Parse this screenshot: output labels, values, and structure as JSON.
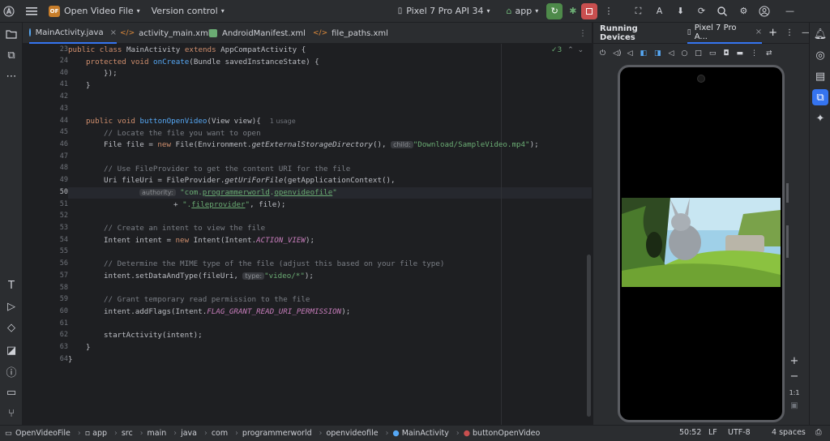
{
  "titlebar": {
    "project_badge": "OF",
    "project_name": "Open Video File",
    "vcs": "Version control",
    "device": "Pixel 7 Pro API 34",
    "run_config": "app"
  },
  "tabs": [
    {
      "label": "MainActivity.java",
      "color": "#56a8f5"
    },
    {
      "label": "activity_main.xml",
      "color": "#e08b3a"
    },
    {
      "label": "AndroidManifest.xml",
      "color": "#6aab73"
    },
    {
      "label": "file_paths.xml",
      "color": "#e08b3a"
    }
  ],
  "inspection_count": "3",
  "lines": {
    "n23": "23",
    "n24": "24",
    "n40": "40",
    "n41": "41",
    "n42": "42",
    "n43": "43",
    "n44": "44",
    "n45": "45",
    "n46": "46",
    "n47": "47",
    "n48": "48",
    "n49": "49",
    "n50": "50",
    "n51": "51",
    "n52": "52",
    "n53": "53",
    "n54": "54",
    "n55": "55",
    "n56": "56",
    "n57": "57",
    "n58": "58",
    "n59": "59",
    "n60": "60",
    "n61": "61",
    "n62": "62",
    "n63": "63",
    "n64": "64"
  },
  "code": {
    "l23a": "public",
    "l23b": " ",
    "l23c": "class",
    "l23d": " MainActivity ",
    "l23e": "extends",
    "l23f": " AppCompatActivity {",
    "l24a": "protected",
    "l24b": " ",
    "l24c": "void",
    "l24d": " ",
    "l24e": "onCreate",
    "l24f": "(Bundle savedInstanceState) {",
    "l40": "});",
    "l41": "}",
    "l44a": "public",
    "l44b": " ",
    "l44c": "void",
    "l44d": " ",
    "l44e": "buttonOpenVideo",
    "l44f": "(View view){",
    "l44usage": "1 usage",
    "l45": "// Locate the file you want to open",
    "l46a": "File file = ",
    "l46b": "new",
    "l46c": " File(Environment.",
    "l46d": "getExternalStorageDirectory",
    "l46e": "(), ",
    "l46hint": "child:",
    "l46f": "\"Download/SampleVideo.mp4\"",
    "l46g": ");",
    "l48": "// Use FileProvider to get the content URI for the file",
    "l49a": "Uri fileUri = FileProvider.",
    "l49b": "getUriForFile",
    "l49c": "(getApplicationContext(),",
    "l50hint": "authority:",
    "l50a": "\"com.",
    "l50b": "programmerworld",
    "l50c": ".",
    "l50d": "openvideofile",
    "l50e": "\"",
    "l51a": "+ ",
    "l51b": "\".",
    "l51c": "fileprovider",
    "l51d": "\"",
    "l51e": ", file);",
    "l53": "// Create an intent to view the file",
    "l54a": "Intent intent = ",
    "l54b": "new",
    "l54c": " Intent(Intent.",
    "l54d": "ACTION_VIEW",
    "l54e": ");",
    "l56": "// Determine the MIME type of the file (adjust this based on your file type)",
    "l57a": "intent.setDataAndType(fileUri, ",
    "l57hint": "type:",
    "l57b": "\"video/*\"",
    "l57c": ");",
    "l59": "// Grant temporary read permission to the file",
    "l60a": "intent.addFlags(Intent.",
    "l60b": "FLAG_GRANT_READ_URI_PERMISSION",
    "l60c": ");",
    "l62": "startActivity(intent);",
    "l63": "}",
    "l64": "}"
  },
  "running_devices": {
    "title": "Running Devices",
    "device_tab": "Pixel 7 Pro A...",
    "zoom_label": "1:1"
  },
  "statusbar": {
    "crumbs": [
      "OpenVideoFile",
      "app",
      "src",
      "main",
      "java",
      "com",
      "programmerworld",
      "openvideofile",
      "MainActivity",
      "buttonOpenVideo"
    ],
    "position": "50:52",
    "line_sep": "LF",
    "encoding": "UTF-8",
    "indent": "4 spaces"
  }
}
